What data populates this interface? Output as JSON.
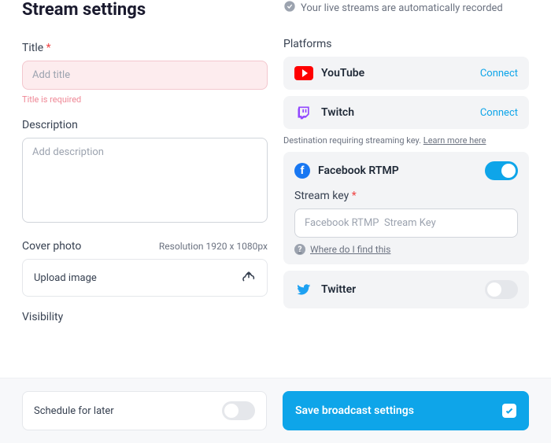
{
  "header": {
    "title": "Stream settings",
    "autoRecord": "Your live streams are automatically recorded"
  },
  "title": {
    "label": "Title",
    "placeholder": "Add title",
    "value": "",
    "error": "Title is required"
  },
  "description": {
    "label": "Description",
    "placeholder": "Add description",
    "value": ""
  },
  "cover": {
    "label": "Cover photo",
    "resolution": "Resolution 1920 x 1080px",
    "upload": "Upload image"
  },
  "visibility": {
    "label": "Visibility"
  },
  "platforms": {
    "label": "Platforms",
    "items": [
      {
        "name": "YouTube",
        "action": "Connect"
      },
      {
        "name": "Twitch",
        "action": "Connect"
      }
    ],
    "destNote": "Destination requiring streaming key.",
    "learnMore": "Learn more here",
    "facebook": {
      "name": "Facebook RTMP",
      "on": true,
      "streamKeyLabel": "Stream key",
      "placeholder": "Facebook RTMP  Stream Key",
      "help": "Where do I find this"
    },
    "twitter": {
      "name": "Twitter",
      "on": false
    }
  },
  "footer": {
    "schedule": "Schedule for later",
    "save": "Save broadcast settings"
  }
}
